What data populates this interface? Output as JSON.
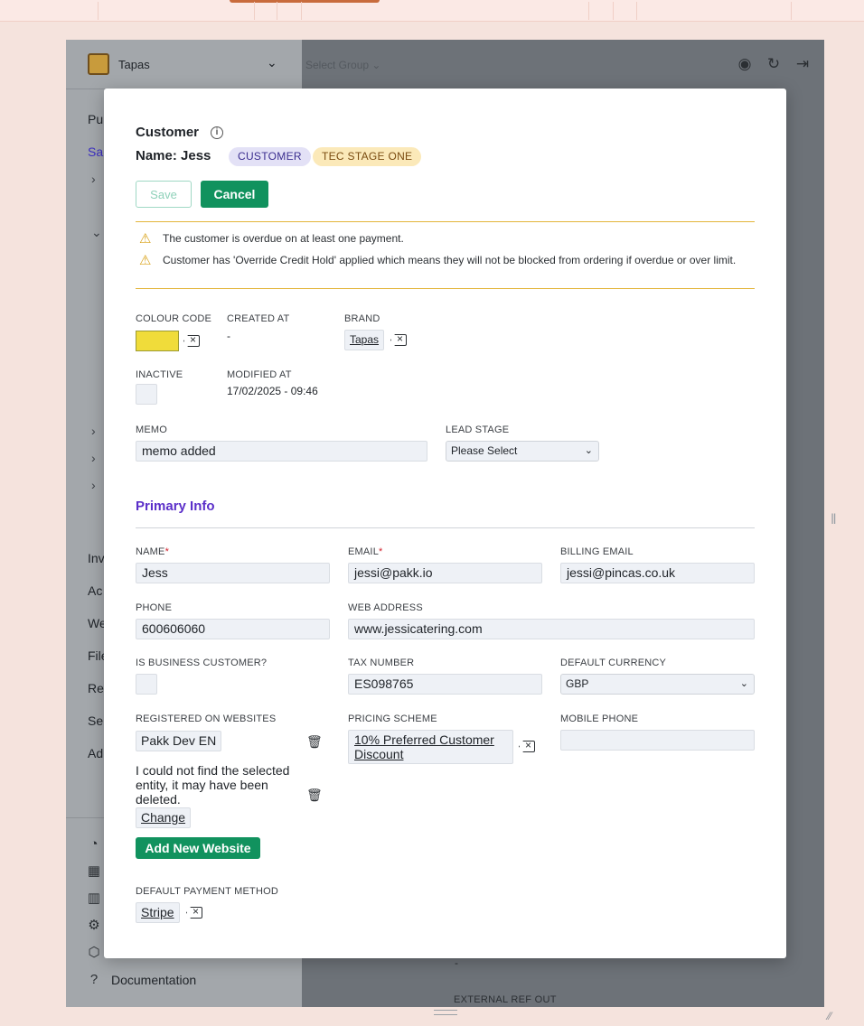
{
  "app": {
    "brand_name": "Tapas",
    "group_selector": "Select Group",
    "sidebar_partial": [
      "Pu",
      "Sa",
      "Inv",
      "Ac",
      "We",
      "File",
      "Re",
      "Se",
      "Ad"
    ],
    "documentation": "Documentation",
    "bg_dash": "-",
    "bg_external_ref": "EXTERNAL REF OUT"
  },
  "modal": {
    "title": "Customer",
    "name_label": "Name:",
    "name_value": "Jess",
    "badges": {
      "type": "CUSTOMER",
      "stage": "TEC STAGE ONE"
    },
    "save_label": "Save",
    "cancel_label": "Cancel",
    "warnings": [
      "The customer is overdue on at least one payment.",
      "Customer has 'Override Credit Hold' applied which means they will not be blocked from ordering if overdue or over limit."
    ],
    "meta": {
      "colour_code_label": "COLOUR CODE",
      "colour_code_value": "#f0dc3a",
      "created_at_label": "CREATED AT",
      "created_at_value": "-",
      "brand_label": "BRAND",
      "brand_value": "Tapas",
      "inactive_label": "INACTIVE",
      "modified_at_label": "MODIFIED AT",
      "modified_at_value": "17/02/2025 - 09:46",
      "memo_label": "MEMO",
      "memo_value": "memo added",
      "lead_stage_label": "LEAD STAGE",
      "lead_stage_value": "Please Select"
    },
    "primary_info": {
      "title": "Primary Info",
      "name_label": "NAME",
      "name_value": "Jess",
      "email_label": "EMAIL",
      "email_value": "jessi@pakk.io",
      "billing_email_label": "BILLING EMAIL",
      "billing_email_value": "jessi@pincas.co.uk",
      "phone_label": "PHONE",
      "phone_value": "600606060",
      "web_address_label": "WEB ADDRESS",
      "web_address_value": "www.jessicatering.com",
      "is_business_label": "IS BUSINESS CUSTOMER?",
      "tax_number_label": "TAX NUMBER",
      "tax_number_value": "ES098765",
      "default_currency_label": "DEFAULT CURRENCY",
      "default_currency_value": "GBP",
      "registered_label": "REGISTERED ON WEBSITES",
      "registered_site": "Pakk Dev EN",
      "entity_missing": "I could not find the selected entity, it may have been deleted.",
      "change_label": "Change",
      "add_website_label": "Add New Website",
      "pricing_label": "PRICING SCHEME",
      "pricing_value": "10% Preferred Customer Discount",
      "mobile_label": "MOBILE PHONE",
      "mobile_value": "",
      "payment_method_label": "DEFAULT PAYMENT METHOD",
      "payment_method_value": "Stripe"
    }
  }
}
